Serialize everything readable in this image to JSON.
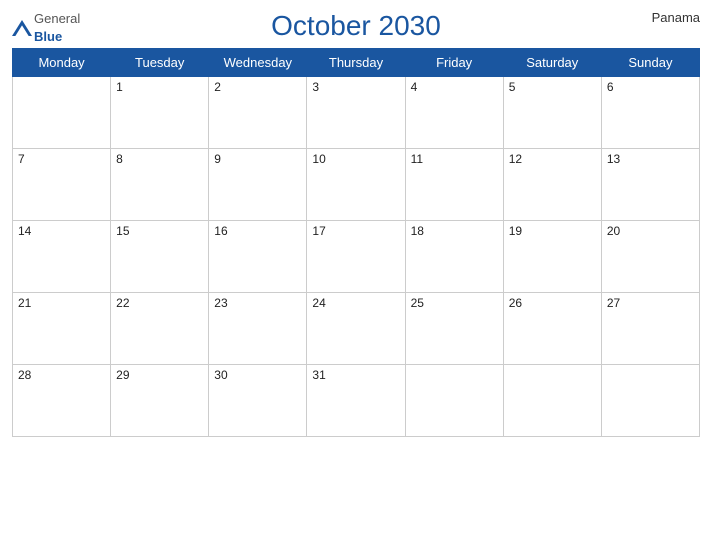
{
  "header": {
    "title": "October 2030",
    "country": "Panama",
    "logo": {
      "general": "General",
      "blue": "Blue"
    }
  },
  "weekdays": [
    "Monday",
    "Tuesday",
    "Wednesday",
    "Thursday",
    "Friday",
    "Saturday",
    "Sunday"
  ],
  "weeks": [
    [
      null,
      1,
      2,
      3,
      4,
      5,
      6
    ],
    [
      7,
      8,
      9,
      10,
      11,
      12,
      13
    ],
    [
      14,
      15,
      16,
      17,
      18,
      19,
      20
    ],
    [
      21,
      22,
      23,
      24,
      25,
      26,
      27
    ],
    [
      28,
      29,
      30,
      31,
      null,
      null,
      null
    ]
  ]
}
